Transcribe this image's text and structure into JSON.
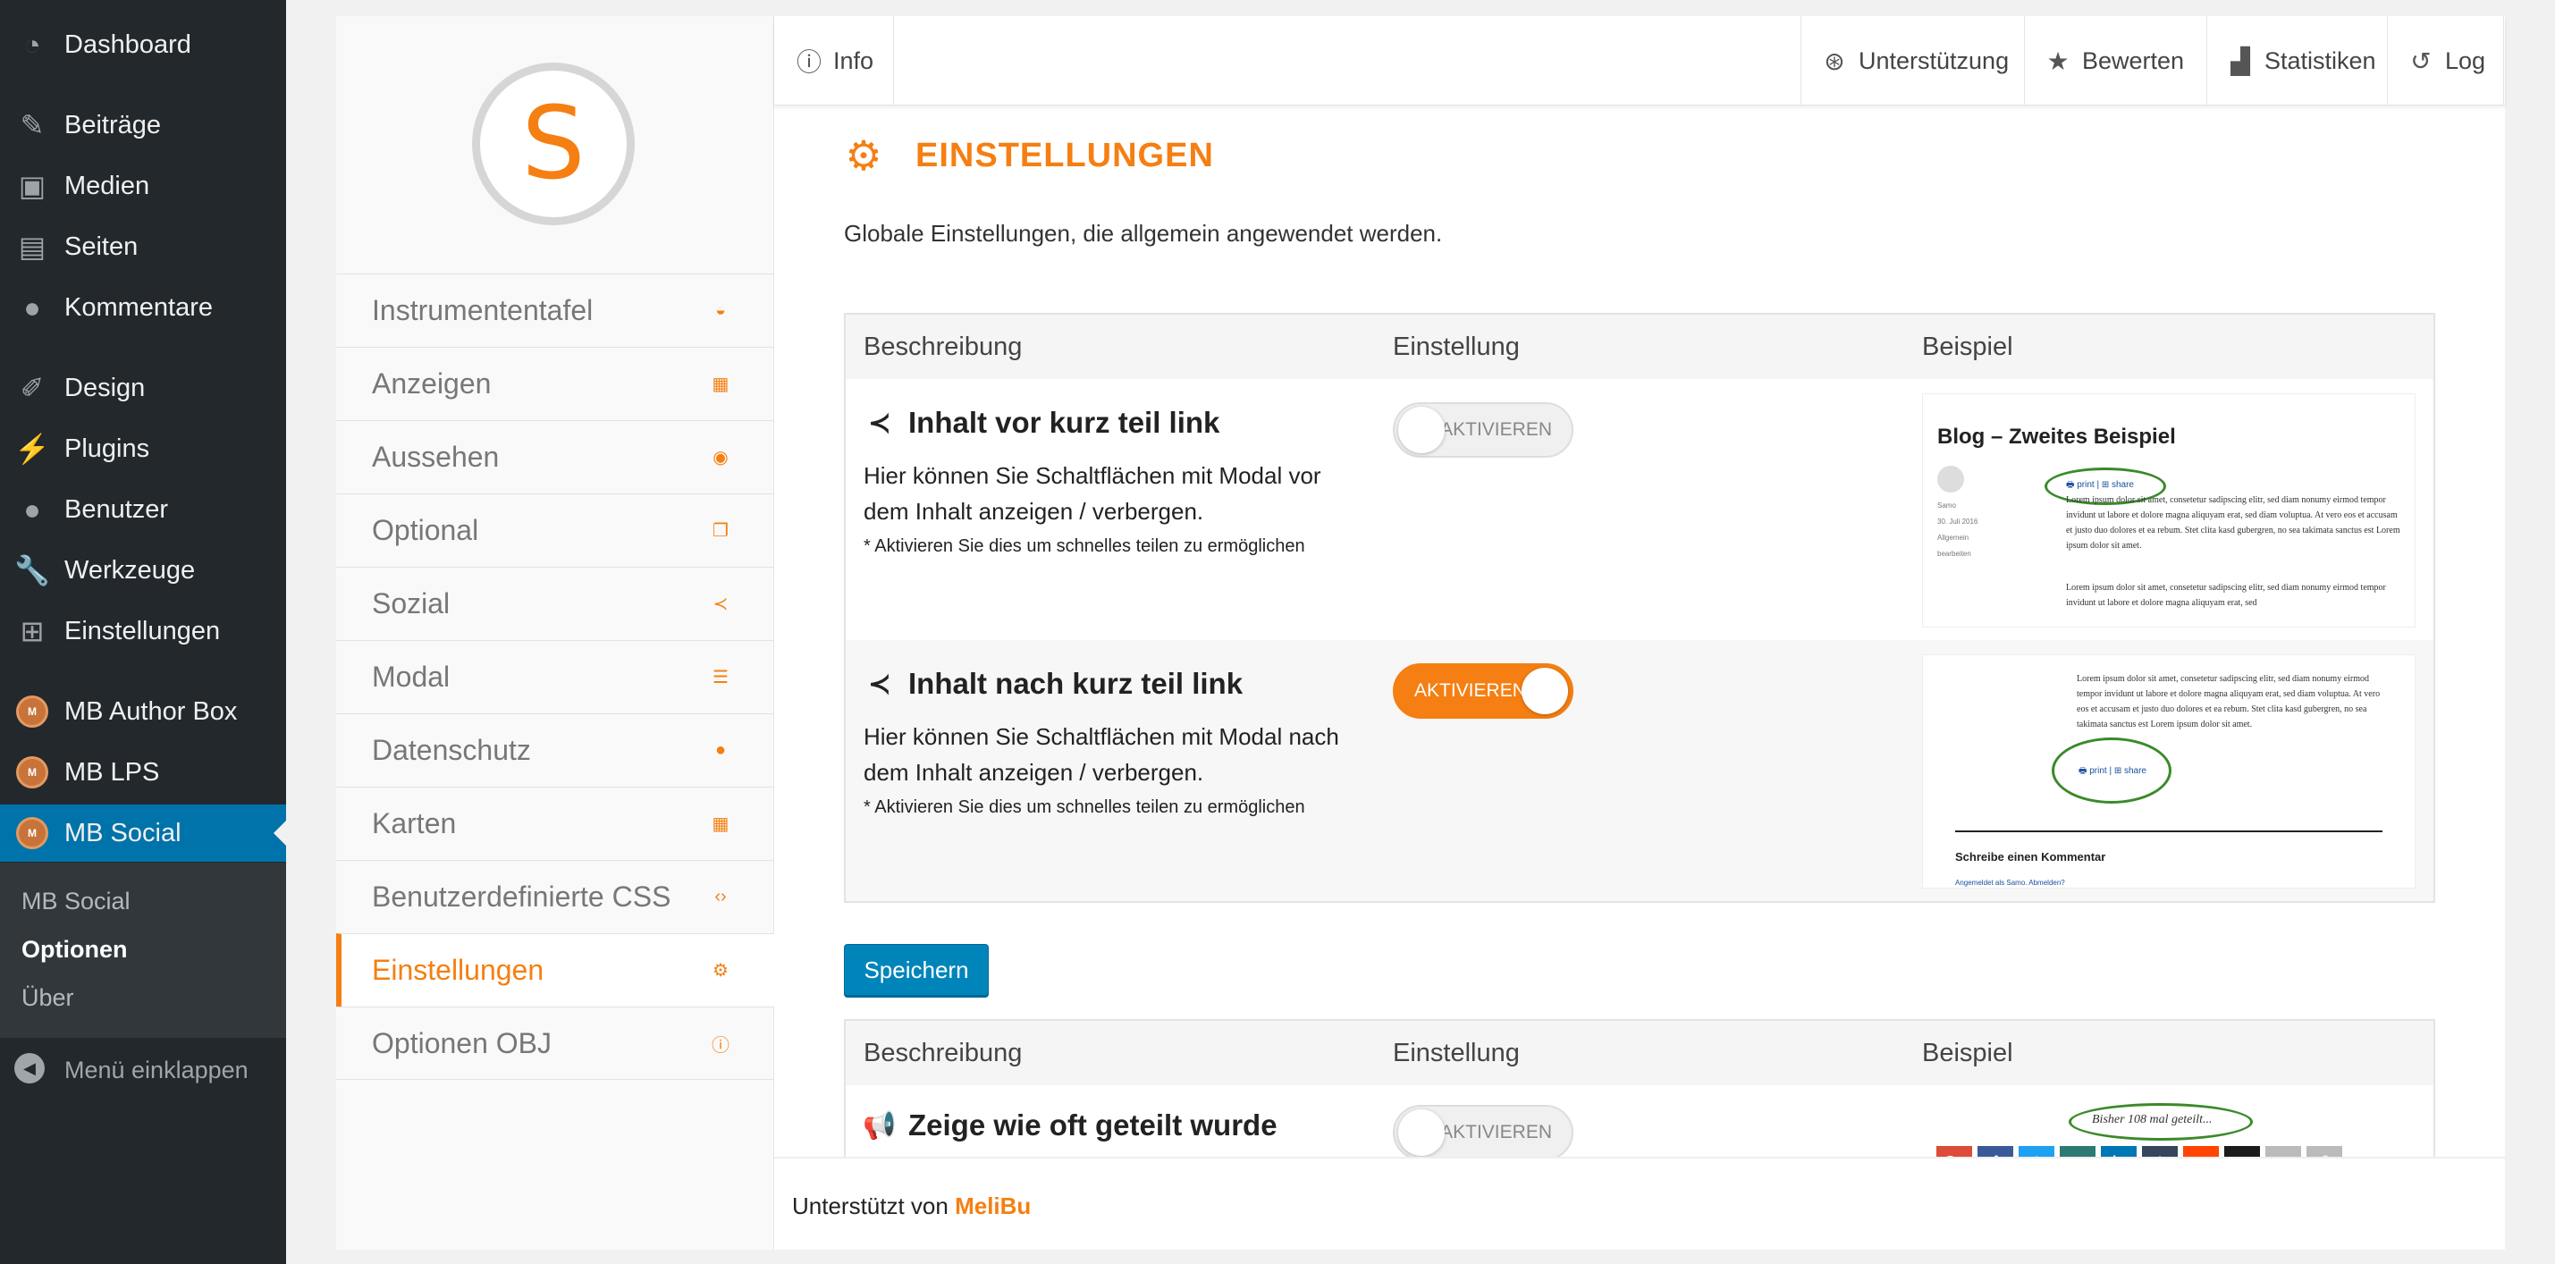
{
  "wp_menu": {
    "items": [
      {
        "label": "Dashboard",
        "icon": "dashboard-icon"
      },
      {
        "label": "Beiträge",
        "icon": "pin-icon"
      },
      {
        "label": "Medien",
        "icon": "media-icon"
      },
      {
        "label": "Seiten",
        "icon": "pages-icon"
      },
      {
        "label": "Kommentare",
        "icon": "comments-icon"
      },
      {
        "label": "Design",
        "icon": "brush-icon"
      },
      {
        "label": "Plugins",
        "icon": "plugin-icon"
      },
      {
        "label": "Benutzer",
        "icon": "user-icon"
      },
      {
        "label": "Werkzeuge",
        "icon": "wrench-icon"
      },
      {
        "label": "Einstellungen",
        "icon": "settings-icon"
      },
      {
        "label": "MB Author Box",
        "icon": "mb-logo-icon"
      },
      {
        "label": "MB LPS",
        "icon": "mb-logo-icon"
      },
      {
        "label": "MB Social",
        "icon": "mb-logo-icon"
      }
    ],
    "active": "MB Social",
    "submenu": [
      "MB Social",
      "Optionen",
      "Über"
    ],
    "submenu_current": "Optionen",
    "collapse_label": "Menü einklappen"
  },
  "plugin_logo_letter": "S",
  "plugin_nav": {
    "items": [
      "Instrumententafel",
      "Anzeigen",
      "Aussehen",
      "Optional",
      "Sozial",
      "Modal",
      "Datenschutz",
      "Karten",
      "Benutzerdefinierte CSS",
      "Einstellungen",
      "Optionen OBJ"
    ],
    "current": "Einstellungen"
  },
  "topbar": {
    "info": "Info",
    "support": "Unterstützung",
    "rate": "Bewerten",
    "stats": "Statistiken",
    "log": "Log"
  },
  "section": {
    "title": "EINSTELLUNGEN",
    "description": "Globale Einstellungen, die allgemein angewendet werden."
  },
  "table1": {
    "headers": [
      "Beschreibung",
      "Einstellung",
      "Beispiel"
    ],
    "rows": [
      {
        "title": "Inhalt vor kurz teil link",
        "desc": "Hier können Sie Schaltflächen mit Modal vor dem Inhalt anzeigen / verbergen.",
        "note": "* Aktivieren Sie dies um schnelles teilen zu ermöglichen",
        "toggle_label": "AKTIVIEREN",
        "toggle_on": false,
        "example": {
          "blog_title": "Blog – Zweites Beispiel",
          "links": "🖶 print | ⊞ share",
          "meta": [
            "Samo",
            "30. Juli 2016",
            "Allgemein",
            "bearbeiten"
          ],
          "lorem1": "Lorem ipsum dolor sit amet, consetetur sadipscing elitr, sed diam nonumy eirmod tempor invidunt ut labore et dolore magna aliquyam erat, sed diam voluptua. At vero eos et accusam et justo duo dolores et ea rebum. Stet clita kasd gubergren, no sea takimata sanctus est Lorem ipsum dolor sit amet.",
          "lorem2": "Lorem ipsum dolor sit amet, consetetur sadipscing elitr, sed diam nonumy eirmod tempor invidunt ut labore et dolore magna aliquyam erat, sed"
        }
      },
      {
        "title": "Inhalt nach kurz teil link",
        "desc": "Hier können Sie Schaltflächen mit Modal nach dem Inhalt anzeigen / verbergen.",
        "note": "* Aktivieren Sie dies um schnelles teilen zu ermöglichen",
        "toggle_label": "AKTIVIEREN",
        "toggle_on": true,
        "example": {
          "lorem": "Lorem ipsum dolor sit amet, consetetur sadipscing elitr, sed diam nonumy eirmod tempor invidunt ut labore et dolore magna aliquyam erat, sed diam voluptua. At vero eos et accusam et justo duo dolores et ea rebum. Stet clita kasd gubergren, no sea takimata sanctus est Lorem ipsum dolor sit amet.",
          "links": "🖶 print | ⊞ share",
          "comment_title": "Schreibe einen Kommentar",
          "comment_login": "Angemeldet als Samo. Abmelden?"
        }
      }
    ]
  },
  "save_label": "Speichern",
  "table2": {
    "headers": [
      "Beschreibung",
      "Einstellung",
      "Beispiel"
    ],
    "row": {
      "title": "Zeige wie oft geteilt wurde",
      "toggle_label": "AKTIVIEREN",
      "toggle_on": false,
      "example_text": "Bisher 108 mal geteilt...",
      "share_buttons": [
        {
          "label": "G+",
          "color": "#dd4b39"
        },
        {
          "label": "f",
          "color": "#3b5998"
        },
        {
          "label": "t",
          "color": "#1da1f2"
        },
        {
          "label": "x",
          "color": "#2c7a72"
        },
        {
          "label": "in",
          "color": "#0077b5"
        },
        {
          "label": "t",
          "color": "#35465c"
        },
        {
          "label": "r",
          "color": "#ff4500"
        },
        {
          "label": "digg",
          "color": "#1b1b1b"
        },
        {
          "label": "✉",
          "color": "#bbbbbb"
        },
        {
          "label": "⎙",
          "color": "#bbbbbb"
        }
      ]
    }
  },
  "footer": {
    "prefix": "Unterstützt von",
    "brand": "MeliBu"
  },
  "colors": {
    "accent": "#f57f12",
    "wp_admin_bar": "#23282d",
    "wp_active": "#0073aa",
    "save_button": "#0085ba"
  }
}
